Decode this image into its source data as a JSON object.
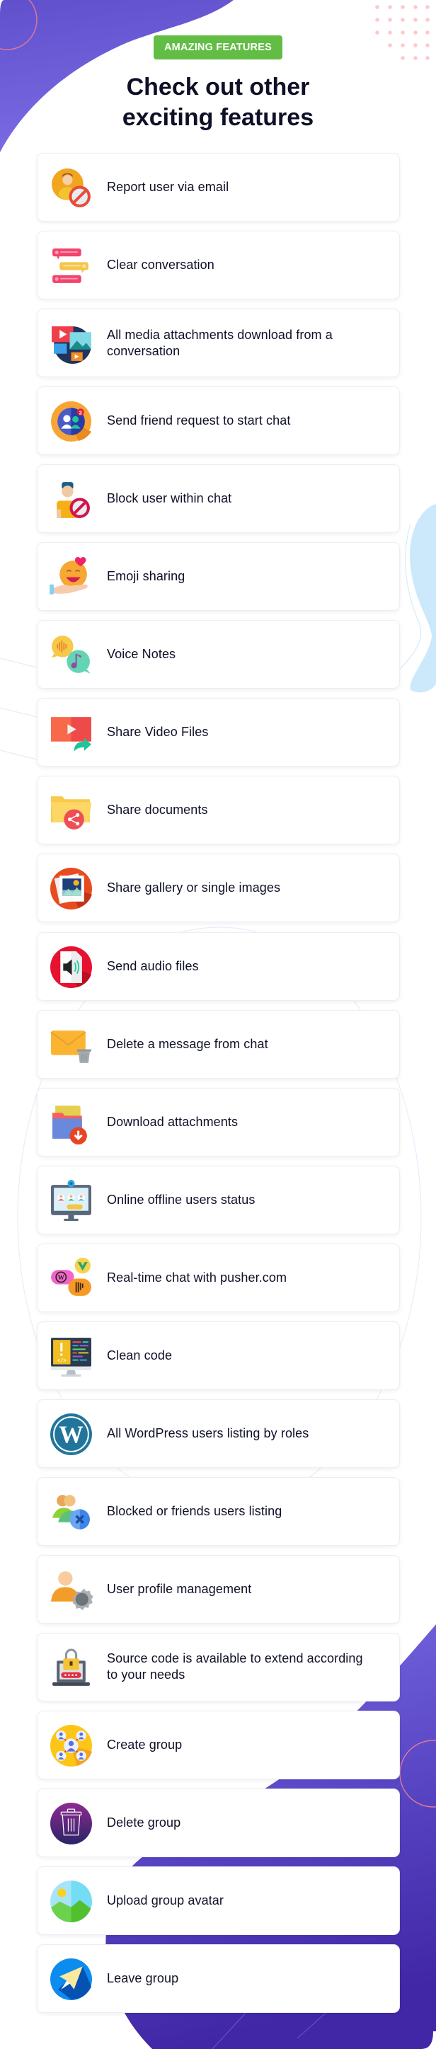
{
  "header": {
    "badge": "AMAZING FEATURES",
    "title_line1": "Check out other",
    "title_line2": "exciting features"
  },
  "colors": {
    "badge_green": "#62bd45",
    "brand_purple": "#6453cf",
    "title_text": "#0e1027",
    "dot_pink": "#ffc8cc",
    "blob_light_blue": "#cbe9fb"
  },
  "features": [
    {
      "label": "Report user via email",
      "icon": "report-user-icon"
    },
    {
      "label": "Clear conversation",
      "icon": "chat-bubbles-icon"
    },
    {
      "label": "All media attachments download from a conversation",
      "icon": "media-attachments-icon"
    },
    {
      "label": "Send friend request to start chat",
      "icon": "friend-request-icon"
    },
    {
      "label": "Block user within chat",
      "icon": "block-user-icon"
    },
    {
      "label": "Emoji sharing",
      "icon": "emoji-icon"
    },
    {
      "label": "Voice Notes",
      "icon": "voice-notes-icon"
    },
    {
      "label": "Share Video Files",
      "icon": "share-video-icon"
    },
    {
      "label": "Share documents",
      "icon": "share-folder-icon"
    },
    {
      "label": "Share gallery or single images",
      "icon": "gallery-icon"
    },
    {
      "label": "Send audio files",
      "icon": "audio-file-icon"
    },
    {
      "label": "Delete a message from chat",
      "icon": "delete-message-icon"
    },
    {
      "label": "Download attachments",
      "icon": "download-folder-icon"
    },
    {
      "label": "Online offline users status",
      "icon": "online-status-monitor-icon"
    },
    {
      "label": "Real-time chat with pusher.com",
      "icon": "realtime-chat-icon"
    },
    {
      "label": "Clean code",
      "icon": "clean-code-icon"
    },
    {
      "label": "All WordPress users listing by roles",
      "icon": "wordpress-icon"
    },
    {
      "label": "Blocked or friends users listing",
      "icon": "blocked-friends-icon"
    },
    {
      "label": "User profile management",
      "icon": "user-settings-icon"
    },
    {
      "label": "Source code is available to extend according to your needs",
      "icon": "locked-laptop-icon"
    },
    {
      "label": "Create group",
      "icon": "create-group-icon"
    },
    {
      "label": "Delete group",
      "icon": "trash-icon"
    },
    {
      "label": "Upload group avatar",
      "icon": "image-avatar-icon"
    },
    {
      "label": "Leave group",
      "icon": "paper-plane-icon"
    }
  ]
}
